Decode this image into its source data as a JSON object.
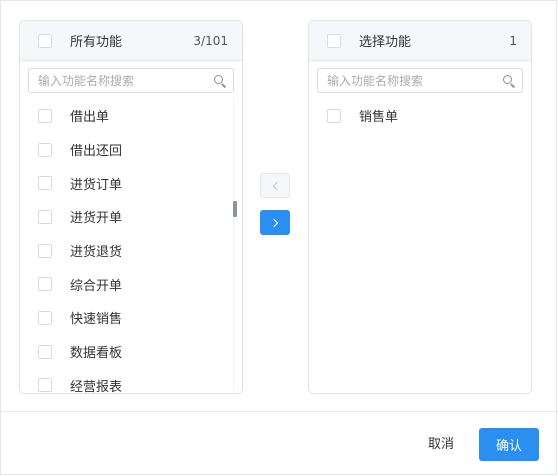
{
  "source_panel": {
    "title": "所有功能",
    "count": "3/101",
    "search_placeholder": "输入功能名称搜索",
    "items": [
      {
        "label": "借出单"
      },
      {
        "label": "借出还回"
      },
      {
        "label": "进货订单"
      },
      {
        "label": "进货开单"
      },
      {
        "label": "进货退货"
      },
      {
        "label": "综合开单"
      },
      {
        "label": "快速销售"
      },
      {
        "label": "数据看板"
      },
      {
        "label": "经营报表"
      }
    ]
  },
  "target_panel": {
    "title": "选择功能",
    "count": "1",
    "search_placeholder": "输入功能名称搜索",
    "items": [
      {
        "label": "销售单"
      }
    ]
  },
  "transfer": {
    "to_left_icon": "chevron-left-icon",
    "to_right_icon": "chevron-right-icon"
  },
  "footer": {
    "cancel_label": "取消",
    "confirm_label": "确认"
  },
  "colors": {
    "accent": "#2a8ff0",
    "header_bg": "#f5f7fa",
    "border": "#e0e3e9"
  }
}
